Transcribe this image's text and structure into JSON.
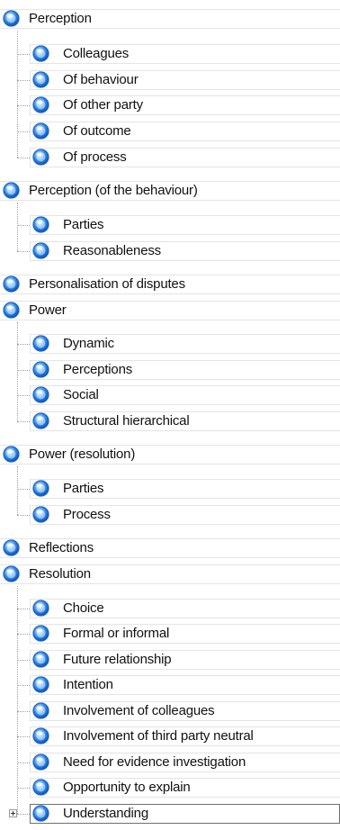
{
  "tree": [
    {
      "id": "perception",
      "label": "Perception",
      "level": 0
    },
    {
      "id": "colleagues",
      "label": "Colleagues",
      "level": 1
    },
    {
      "id": "of-behaviour",
      "label": "Of behaviour",
      "level": 1
    },
    {
      "id": "of-other-party",
      "label": "Of other party",
      "level": 1
    },
    {
      "id": "of-outcome",
      "label": "Of outcome",
      "level": 1
    },
    {
      "id": "of-process",
      "label": "Of process",
      "level": 1
    },
    {
      "id": "perception-of-the-behaviour",
      "label": "Perception (of the behaviour)",
      "level": 0
    },
    {
      "id": "parties",
      "label": "Parties",
      "level": 1
    },
    {
      "id": "reasonableness",
      "label": "Reasonableness",
      "level": 1
    },
    {
      "id": "personalisation-of-disputes",
      "label": "Personalisation of disputes",
      "level": 0
    },
    {
      "id": "power",
      "label": "Power",
      "level": 0
    },
    {
      "id": "dynamic",
      "label": "Dynamic",
      "level": 1
    },
    {
      "id": "perceptions",
      "label": "Perceptions",
      "level": 1
    },
    {
      "id": "social",
      "label": "Social",
      "level": 1
    },
    {
      "id": "structural-hierarchical",
      "label": "Structural hierarchical",
      "level": 1
    },
    {
      "id": "power-resolution",
      "label": "Power (resolution)",
      "level": 0
    },
    {
      "id": "parties-2",
      "label": "Parties",
      "level": 1
    },
    {
      "id": "process",
      "label": "Process",
      "level": 1
    },
    {
      "id": "reflections",
      "label": "Reflections",
      "level": 0
    },
    {
      "id": "resolution",
      "label": "Resolution",
      "level": 0
    },
    {
      "id": "choice",
      "label": "Choice",
      "level": 1
    },
    {
      "id": "formal-or-informal",
      "label": "Formal or informal",
      "level": 1
    },
    {
      "id": "future-relationship",
      "label": "Future relationship",
      "level": 1
    },
    {
      "id": "intention",
      "label": "Intention",
      "level": 1
    },
    {
      "id": "involvement-of-colleagues",
      "label": "Involvement of colleagues",
      "level": 1
    },
    {
      "id": "involvement-of-third-party-neutral",
      "label": "Involvement of third party neutral",
      "level": 1
    },
    {
      "id": "need-for-evidence-investigation",
      "label": "Need for evidence investigation",
      "level": 1
    },
    {
      "id": "opportunity-to-explain",
      "label": "Opportunity to explain",
      "level": 1
    },
    {
      "id": "understanding",
      "label": "Understanding",
      "level": 1,
      "expander": "collapsed",
      "selected": true
    }
  ],
  "colors": {
    "node_icon_light": "#cfeaff",
    "node_icon_mid": "#3f93e6",
    "node_icon_dark": "#0b4fb3",
    "node_icon_ring": "#1e62c9",
    "row_border": "#e4e4e4",
    "tree_lines": "#a0a0a0",
    "selection_border": "#6f6f6f"
  },
  "icons": {
    "node": "blue-orb-icon",
    "expander_collapsed": "plus-expander-icon"
  }
}
